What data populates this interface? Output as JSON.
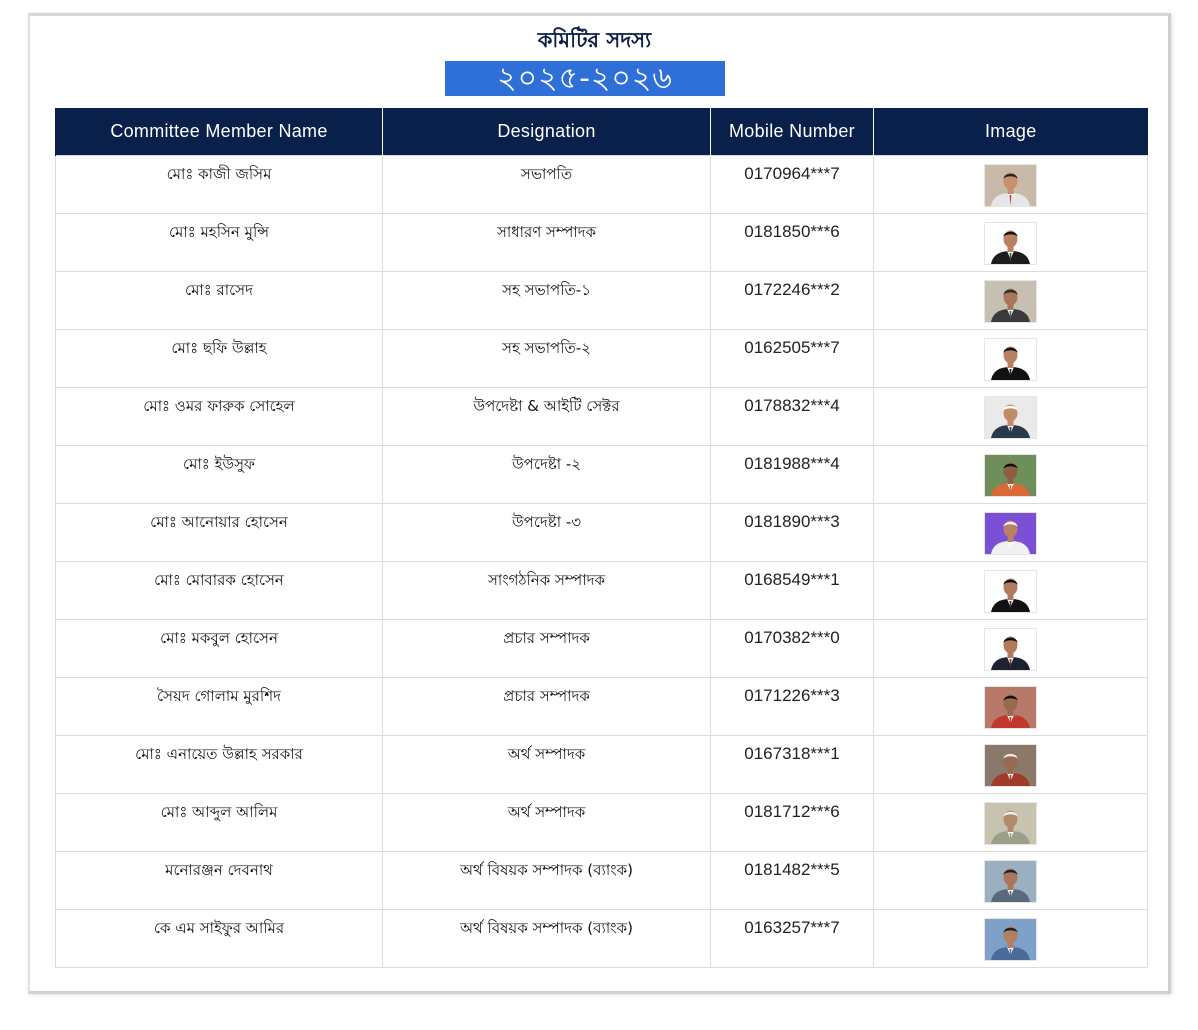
{
  "header": {
    "title": "কমিটির সদস্য",
    "year": "২০২৫-২০২৬"
  },
  "table": {
    "columns": [
      "Committee Member Name",
      "Designation",
      "Mobile Number",
      "Image"
    ],
    "rows": [
      {
        "name": "মোঃ কাজী জসিম",
        "designation": "সভাপতি",
        "mobile": "0170964***7",
        "photo": {
          "bg": "#c9b9a8",
          "shirt": "#e6e6e6",
          "skin": "#c98f6d",
          "hair": "#222222",
          "tie": "#b23a3a"
        }
      },
      {
        "name": "মোঃ মহসিন মুন্সি",
        "designation": "সাধারণ সম্পাদক",
        "mobile": "0181850***6",
        "photo": {
          "bg": "#ffffff",
          "shirt": "#1d1d1d",
          "skin": "#b98062",
          "hair": "#111111",
          "tie": "#2a6a2a"
        }
      },
      {
        "name": "মোঃ রাসেদ",
        "designation": "সহ সভাপতি-১",
        "mobile": "0172246***2",
        "photo": {
          "bg": "#c7c0b2",
          "shirt": "#3a3a3a",
          "skin": "#a8765a",
          "hair": "#2a2a2a",
          "tie": "#555555"
        }
      },
      {
        "name": "মোঃ ছফি উল্লাহ",
        "designation": "সহ সভাপতি-২",
        "mobile": "0162505***7",
        "photo": {
          "bg": "#ffffff",
          "shirt": "#111111",
          "skin": "#b98062",
          "hair": "#111111",
          "tie": "#1a1a1a"
        }
      },
      {
        "name": "মোঃ ওমর ফারুক সোহেল",
        "designation": "উপদেষ্টা & আইটি সেক্টর",
        "mobile": "0178832***4",
        "photo": {
          "bg": "#eaeaea",
          "shirt": "#2b3a4a",
          "skin": "#c28a68",
          "hair": "#ffffff",
          "tie": "#2b3a4a"
        }
      },
      {
        "name": "মোঃ ইউসুফ",
        "designation": "উপদেষ্টা -২",
        "mobile": "0181988***4",
        "photo": {
          "bg": "#6e8f5a",
          "shirt": "#d86a3a",
          "skin": "#8f5f45",
          "hair": "#111111",
          "tie": "#d86a3a"
        }
      },
      {
        "name": "মোঃ আনোয়ার হোসেন",
        "designation": "উপদেষ্টা -৩",
        "mobile": "0181890***3",
        "photo": {
          "bg": "#7b4fd6",
          "shirt": "#f0f0f0",
          "skin": "#b98062",
          "hair": "#f4f4f4",
          "tie": "#f0f0f0"
        }
      },
      {
        "name": "মোঃ মোবারক হোসেন",
        "designation": "সাংগঠনিক সম্পাদক",
        "mobile": "0168549***1",
        "photo": {
          "bg": "#ffffff",
          "shirt": "#111111",
          "skin": "#b07a5c",
          "hair": "#111111",
          "tie": "#333333"
        }
      },
      {
        "name": "মোঃ মকবুল হোসেন",
        "designation": "প্রচার সম্পাদক",
        "mobile": "0170382***0",
        "photo": {
          "bg": "#ffffff",
          "shirt": "#1c2230",
          "skin": "#b07a5c",
          "hair": "#111111",
          "tie": "#8a2a2a"
        }
      },
      {
        "name": "সৈয়দ গোলাম মুরশিদ",
        "designation": "প্রচার সম্পাদক",
        "mobile": "0171226***3",
        "photo": {
          "bg": "#b8786a",
          "shirt": "#c0392b",
          "skin": "#9a6a50",
          "hair": "#111111",
          "tie": "#c0392b"
        }
      },
      {
        "name": "মোঃ এনায়েত উল্লাহ সরকার",
        "designation": "অর্থ সম্পাদক",
        "mobile": "0167318***1",
        "photo": {
          "bg": "#8a7868",
          "shirt": "#a03a2a",
          "skin": "#9a6a50",
          "hair": "#e8e8e8",
          "tie": "#a03a2a"
        }
      },
      {
        "name": "মোঃ আব্দুল আলিম",
        "designation": "অর্থ সম্পাদক",
        "mobile": "0181712***6",
        "photo": {
          "bg": "#c8c2b0",
          "shirt": "#9aa08a",
          "skin": "#b08a6a",
          "hair": "#eeeeee",
          "tie": "#9aa08a"
        }
      },
      {
        "name": "মনোরঞ্জন দেবনাথ",
        "designation": "অর্থ বিষয়ক সম্পাদক (ব্যাংক)",
        "mobile": "0181482***5",
        "photo": {
          "bg": "#9ab0c0",
          "shirt": "#5a6a7a",
          "skin": "#a8765a",
          "hair": "#222222",
          "tie": "#5a6a7a"
        }
      },
      {
        "name": "কে এম সাইফুর আমির",
        "designation": "অর্থ বিষয়ক সম্পাদক (ব্যাংক)",
        "mobile": "0163257***7",
        "photo": {
          "bg": "#7fa0c8",
          "shirt": "#4a6a9a",
          "skin": "#b08060",
          "hair": "#222222",
          "tie": "#4a6a9a"
        }
      }
    ]
  },
  "colors": {
    "header_bg": "#08204a",
    "title_color": "#0b1e45",
    "year_badge_bg": "#2f6fd8",
    "border": "#dcdcdc"
  }
}
